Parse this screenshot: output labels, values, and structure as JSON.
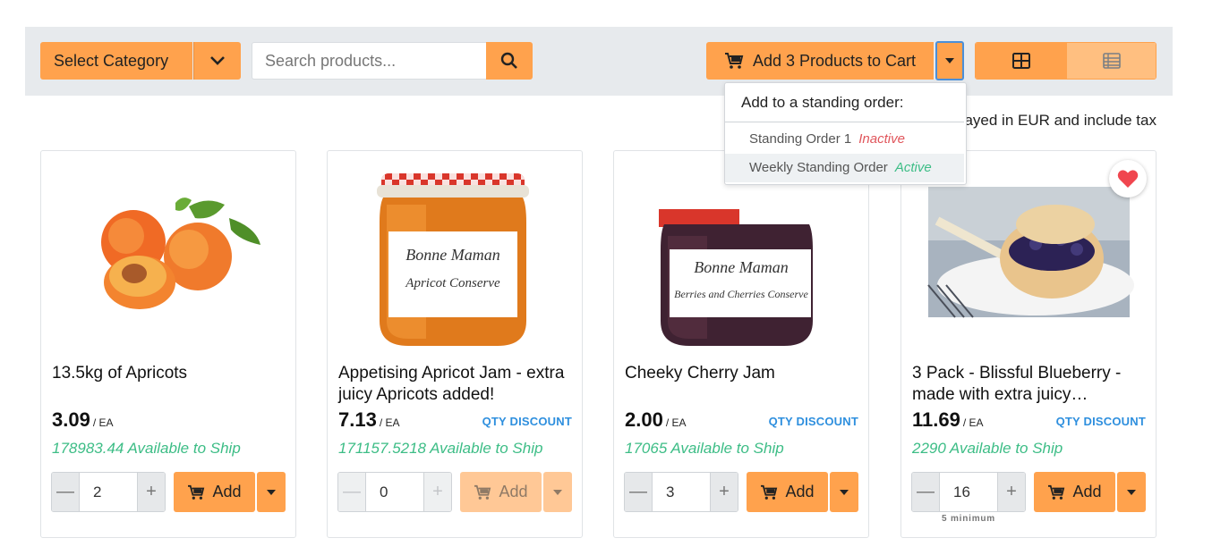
{
  "toolbar": {
    "category_label": "Select Category",
    "search_placeholder": "Search products...",
    "add_to_cart_label": "Add 3 Products to Cart"
  },
  "dropdown": {
    "header": "Add to a standing order:",
    "items": [
      {
        "name": "Standing Order 1",
        "status": "Inactive",
        "status_color": "#e0555b"
      },
      {
        "name": "Weekly Standing Order",
        "status": "Active",
        "status_color": "#3dbd86"
      }
    ]
  },
  "notice": "ayed in EUR and include tax",
  "colors": {
    "accent": "#ffa24d",
    "available": "#3dbd86",
    "qty_discount": "#2e8fde",
    "heart": "#f0464f"
  },
  "products": [
    {
      "title": "13.5kg of Apricots",
      "price": "3.09",
      "unit": "/ EA",
      "qty_discount": "",
      "available": "178983.44 Available to Ship",
      "qty": "2",
      "add_label": "Add",
      "minimum": "",
      "image": "apricots"
    },
    {
      "title": "Appetising Apricot Jam - extra juicy Apricots added!",
      "price": "7.13",
      "unit": "/ EA",
      "qty_discount": "QTY DISCOUNT",
      "available": "171157.5218 Available to Ship",
      "qty": "0",
      "add_label": "Add",
      "minimum": "",
      "image": "apricot-jam-jar",
      "jar_brand": "Bonne Maman",
      "jar_label": "Apricot Conserve"
    },
    {
      "title": "Cheeky Cherry Jam",
      "price": "2.00",
      "unit": "/ EA",
      "qty_discount": "QTY DISCOUNT",
      "available": "17065 Available to Ship",
      "qty": "3",
      "add_label": "Add",
      "minimum": "",
      "image": "cherry-jam-jar",
      "jar_brand": "Bonne Maman",
      "jar_label": "Berries and Cherries Conserve"
    },
    {
      "title": "3 Pack - Blissful Blueberry - made with extra juicy…",
      "price": "11.69",
      "unit": "/ EA",
      "qty_discount": "QTY DISCOUNT",
      "available": "2290 Available to Ship",
      "qty": "16",
      "add_label": "Add",
      "minimum": "5 minimum",
      "image": "blueberry-scone",
      "favorited": true
    }
  ],
  "icons": {
    "step_minus": "—",
    "step_plus": "+"
  }
}
